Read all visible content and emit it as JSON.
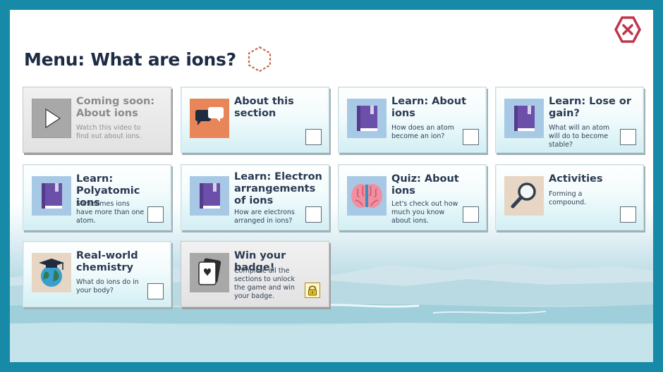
{
  "header": {
    "title": "Menu: What are ions?"
  },
  "tiles": [
    {
      "title": "Coming soon: About ions",
      "desc": "Watch this video to find out about ions.",
      "icon": "play-icon",
      "state": "disabled"
    },
    {
      "title": "About this section",
      "desc": "",
      "icon": "speech-bubbles-icon",
      "state": "unchecked"
    },
    {
      "title": "Learn: About ions",
      "desc": "How does an atom become an ion?",
      "icon": "book-icon",
      "state": "unchecked"
    },
    {
      "title": "Learn: Lose or gain?",
      "desc": "What will an atom will do to become stable?",
      "icon": "book-icon",
      "state": "unchecked"
    },
    {
      "title": "Learn: Polyatomic ions",
      "desc": "Sometimes ions have more than one atom.",
      "icon": "book-icon",
      "state": "unchecked"
    },
    {
      "title": "Learn: Electron arrangements of ions",
      "desc": "How are electrons arranged in ions?",
      "icon": "book-icon",
      "state": "unchecked"
    },
    {
      "title": "Quiz: About ions",
      "desc": "Let's check out how much you know about ions.",
      "icon": "brain-icon",
      "state": "unchecked"
    },
    {
      "title": "Activities",
      "desc": "Forming a compound.",
      "icon": "magnifier-icon",
      "state": "unchecked"
    },
    {
      "title": "Real-world chemistry",
      "desc": "What do ions do in your body?",
      "icon": "globe-graduation-icon",
      "state": "unchecked"
    },
    {
      "title": "Win your badge!",
      "desc": "Complete all the sections to unlock the game and win your badge.",
      "icon": "cards-heart-icon",
      "state": "locked"
    }
  ],
  "colors": {
    "border": "#168aa6",
    "title_text": "#1d2b45",
    "close_icon": "#c0354a",
    "badge_outline": "#c46a4a"
  }
}
